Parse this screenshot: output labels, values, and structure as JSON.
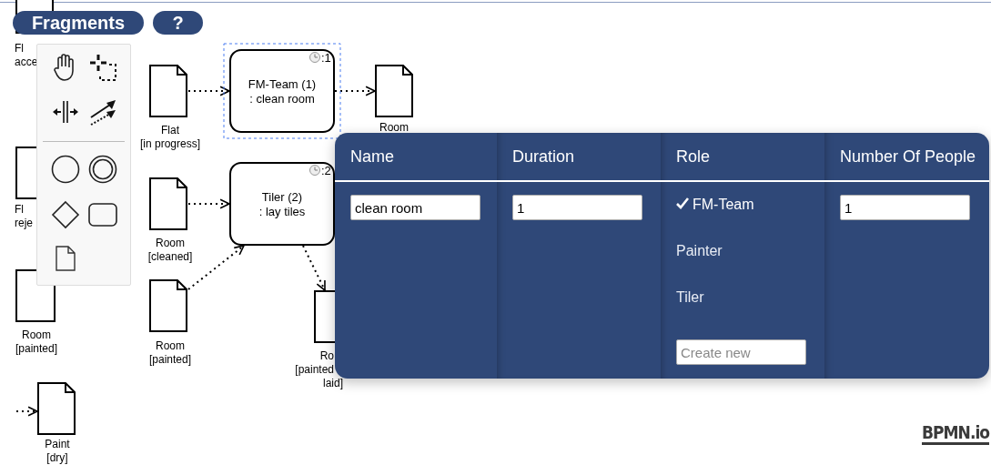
{
  "toolbar": {
    "buttons": [
      {
        "label": "Fragments"
      },
      {
        "label": "?"
      }
    ]
  },
  "diagram": {
    "tasks": [
      {
        "lines": [
          "FM-Team (1)",
          ": clean room"
        ],
        "badge": ":1",
        "selected": true
      },
      {
        "lines": [
          "Tiler (2)",
          ": lay tiles"
        ],
        "badge": ":2",
        "selected": false
      }
    ],
    "data_objects": [
      {
        "lines": [
          "Fl",
          "acce"
        ]
      },
      {
        "lines": [
          "Fl",
          "reje"
        ]
      },
      {
        "lines": [
          "Room",
          "[painted]"
        ]
      },
      {
        "lines": [
          "Paint",
          "[dry]"
        ]
      },
      {
        "lines": [
          "Flat",
          "[in progress]"
        ]
      },
      {
        "lines": [
          "Room",
          "[cleaned]"
        ]
      },
      {
        "lines": [
          "Room",
          "[painted]"
        ]
      },
      {
        "lines": [
          "Room"
        ]
      },
      {
        "lines": [
          "Ro",
          "[painted",
          "laid]"
        ]
      }
    ]
  },
  "activity_panel": {
    "columns": [
      "Name",
      "Duration",
      "Role",
      "Number Of People"
    ],
    "name": "clean room",
    "duration": "1",
    "roles": [
      {
        "label": "FM-Team",
        "selected": true
      },
      {
        "label": "Painter",
        "selected": false
      },
      {
        "label": "Tiler",
        "selected": false
      }
    ],
    "new_role_placeholder": "Create new",
    "number_of_people": "1"
  },
  "logo": "BPMN.io"
}
